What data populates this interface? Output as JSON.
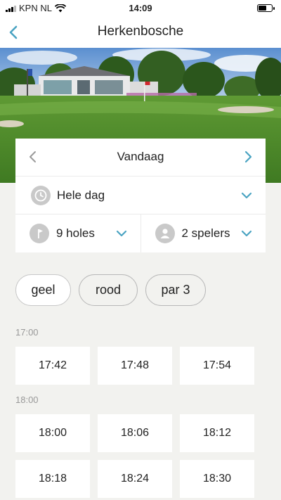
{
  "status_bar": {
    "carrier": "KPN NL",
    "time": "14:09",
    "battery_level": 0.6
  },
  "navbar": {
    "title": "Herkenbosche"
  },
  "filters": {
    "date_label": "Vandaag",
    "day_part": "Hele dag",
    "holes": "9 holes",
    "players": "2 spelers"
  },
  "chips": [
    {
      "label": "geel",
      "selected": true
    },
    {
      "label": "rood",
      "selected": false
    },
    {
      "label": "par 3",
      "selected": false
    }
  ],
  "slot_groups": [
    {
      "label": "17:00",
      "times": [
        "17:42",
        "17:48",
        "17:54"
      ]
    },
    {
      "label": "18:00",
      "times": [
        "18:00",
        "18:06",
        "18:12",
        "18:18",
        "18:24",
        "18:30"
      ]
    }
  ],
  "colors": {
    "accent": "#4aa3c2",
    "icon_grey": "#c9c9c9",
    "background": "#f2f2ef"
  },
  "icons": {
    "back": "chevron-left-icon",
    "prev": "chevron-left-icon",
    "next": "chevron-right-icon",
    "clock": "clock-icon",
    "flag": "flag-icon",
    "person": "person-icon",
    "dropdown": "chevron-down-icon"
  }
}
